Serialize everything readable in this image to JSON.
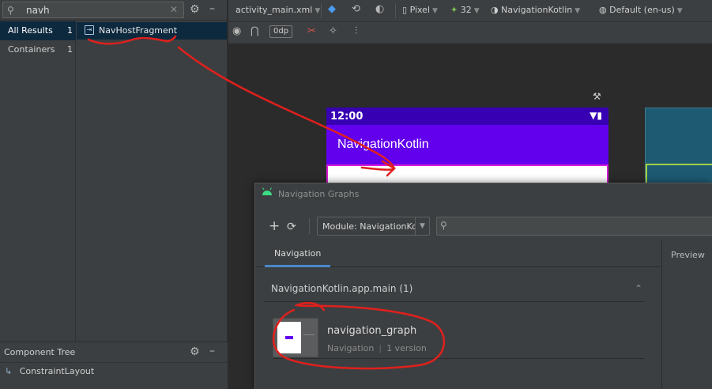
{
  "palette": {
    "search": {
      "value": "navh",
      "search_icon": "search-icon",
      "clear_icon": "close-icon"
    },
    "categories": [
      {
        "label": "All Results",
        "count": "1",
        "selected": true
      },
      {
        "label": "Containers",
        "count": "1",
        "selected": false
      }
    ],
    "results": [
      {
        "label": "NavHostFragment",
        "icon": "nav-host-fragment-icon"
      }
    ]
  },
  "component_tree": {
    "title": "Component Tree",
    "root": "ConstraintLayout"
  },
  "toolbar": {
    "file": "activity_main.xml",
    "device": "Pixel",
    "api": "32",
    "theme": "NavigationKotlin",
    "locale": "Default (en-us)",
    "margin": "0dp"
  },
  "phone": {
    "time": "12:00",
    "app_title": "NavigationKotlin",
    "status_bar_color": "#3700b3",
    "app_bar_color": "#6200ee",
    "selection_color": "#d81bd8"
  },
  "dialog": {
    "title": "Navigation Graphs",
    "module": "Module: NavigationKotlin",
    "tab": "Navigation",
    "preview_label": "Preview",
    "group": "NavigationKotlin.app.main (1)",
    "items": [
      {
        "name": "navigation_graph",
        "type": "Navigation",
        "versions": "1 version"
      }
    ]
  },
  "colors": {
    "annotation": "#e0201d",
    "accent": "#4a88c7"
  }
}
